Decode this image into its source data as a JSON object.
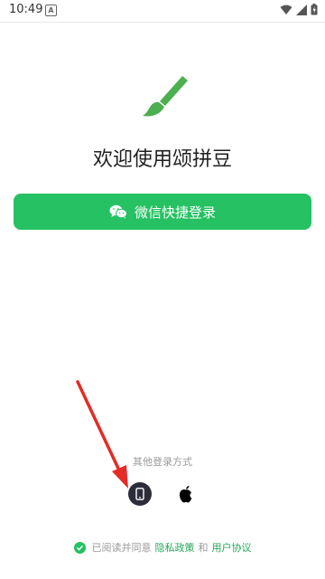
{
  "status_bar": {
    "time": "10:49",
    "notification_letter": "A"
  },
  "welcome": {
    "title": "欢迎使用颂拼豆"
  },
  "wechat_login": {
    "label": "微信快捷登录"
  },
  "other_methods": {
    "label": "其他登录方式"
  },
  "agreement": {
    "prefix": "已阅读并同意",
    "privacy": "隐私政策",
    "and": "和",
    "user_agreement": "用户协议"
  },
  "colors": {
    "brand_green": "#25c162",
    "link_green": "#25a85a",
    "arrow_red": "#e52b25"
  }
}
